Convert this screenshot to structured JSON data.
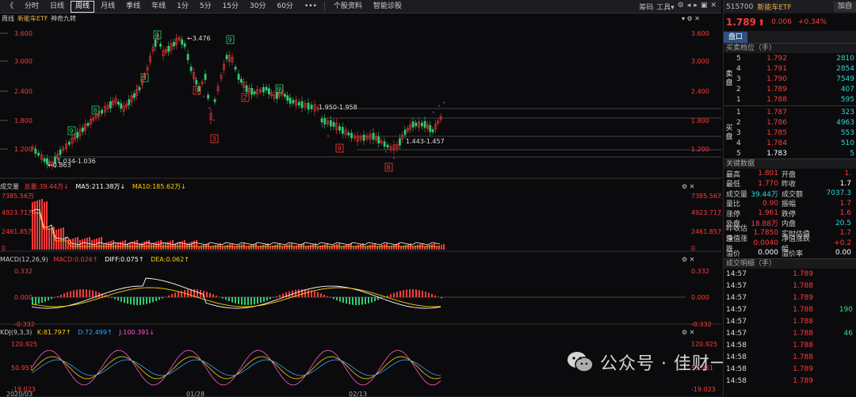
{
  "toolbar": {
    "back": "《",
    "items": [
      "分时",
      "日线",
      "周线",
      "月线",
      "季线",
      "年线",
      "1分",
      "5分",
      "15分",
      "30分",
      "60分",
      "•••",
      "个股资料",
      "智能诊股"
    ],
    "active": "周线",
    "right": [
      "筹码",
      "工具▾",
      "⚙",
      "◂",
      "▸",
      "▣",
      "✕"
    ]
  },
  "main_header": {
    "period": "周线",
    "name": "新能车ETF",
    "indicator": "神奇九转"
  },
  "price_axis": {
    "left": [
      "3.600",
      "3.000",
      "2.400",
      "1.800",
      "1.200"
    ],
    "right": [
      "3.600",
      "3.000",
      "2.400",
      "1.800",
      "1.200"
    ]
  },
  "annotations": {
    "high": "3.476",
    "low": "0.863",
    "low_range": "1.034-1.036",
    "mid_range": "1.950-1.958",
    "recent_range": "1.443-1.457",
    "arrow": "←"
  },
  "nine_turn_green": [
    "9",
    "8",
    "9",
    "9",
    "9",
    "9"
  ],
  "nine_turn_red": [
    "9",
    "2",
    "3",
    "9",
    "8",
    "9"
  ],
  "volume": {
    "title": "成交量",
    "total_label": "总量:39.44万↓",
    "ma5": "MA5:211.38万↓",
    "ma10": "MA10:185.62万↓",
    "axis": [
      "7385.56万",
      "4923.71万",
      "2461.85万",
      "0"
    ]
  },
  "macd": {
    "title": "MACD(12,26,9)",
    "macd": "MACD:0.026↑",
    "diff": "DIFF:0.075↑",
    "dea": "DEA:0.062↑",
    "axis": [
      "0.332",
      "0.000",
      "-0.332"
    ]
  },
  "kdj": {
    "title": "KDJ(9,3,3)",
    "k": "K:81.797↑",
    "d": "D:72.499↑",
    "j": "J:100.391↓",
    "axis": [
      "120.925",
      "50.951",
      "-19.023"
    ]
  },
  "dates": [
    "2020/03",
    "01/28",
    "02/13"
  ],
  "panel": {
    "code": "515700",
    "name": "新能车ETF",
    "add": "加自",
    "price": "1.789",
    "arrow": "🡅",
    "change": "0.006",
    "pct": "+0.34%",
    "tab": "盘口",
    "orderbook_title": "买卖档位（手）",
    "sell_side": "卖盘",
    "buy_side": "买盘",
    "asks": [
      {
        "l": "5",
        "p": "1.792",
        "v": "2810"
      },
      {
        "l": "4",
        "p": "1.791",
        "v": "2854"
      },
      {
        "l": "3",
        "p": "1.790",
        "v": "7549"
      },
      {
        "l": "2",
        "p": "1.789",
        "v": "407"
      },
      {
        "l": "1",
        "p": "1.788",
        "v": "595"
      }
    ],
    "bids": [
      {
        "l": "1",
        "p": "1.787",
        "v": "323"
      },
      {
        "l": "2",
        "p": "1.786",
        "v": "4963"
      },
      {
        "l": "3",
        "p": "1.785",
        "v": "553"
      },
      {
        "l": "4",
        "p": "1.784",
        "v": "510"
      },
      {
        "l": "5",
        "p": "1.783",
        "v": "5"
      }
    ],
    "key_title": "关键数据",
    "key": [
      {
        "k": "最高",
        "v": "1.801",
        "k2": "开盘",
        "v2": "1."
      },
      {
        "k": "最低",
        "v": "1.770",
        "k2": "昨收",
        "v2": "1.7"
      },
      {
        "k": "成交量",
        "v": "39.44万",
        "k2": "成交额",
        "v2": "7037.3"
      },
      {
        "k": "量比",
        "v": "0.90",
        "k2": "振幅",
        "v2": "1.7"
      },
      {
        "k": "涨停",
        "v": "1.961",
        "k2": "跌停",
        "v2": "1.6"
      },
      {
        "k": "外盘",
        "v": "18.88万",
        "k2": "内盘",
        "v2": "20.5"
      },
      {
        "k": "昨收估值",
        "v": "1.7850",
        "k2": "实时估值",
        "v2": "1.7"
      },
      {
        "k": "净值涨跌",
        "v": "0.0040",
        "k2": "净值涨跌幅",
        "v2": "+0.2"
      },
      {
        "k": "溢价",
        "v": "0.000",
        "k2": "溢价率",
        "v2": "0.00"
      }
    ],
    "trades_title": "成交明细（手）",
    "trades": [
      {
        "t": "14:57",
        "p": "1.789",
        "q": ""
      },
      {
        "t": "14:57",
        "p": "1.788",
        "q": ""
      },
      {
        "t": "14:57",
        "p": "1.789",
        "q": ""
      },
      {
        "t": "14:57",
        "p": "1.788",
        "q": "190"
      },
      {
        "t": "14:57",
        "p": "1.788",
        "q": ""
      },
      {
        "t": "14:57",
        "p": "1.788",
        "q": "46"
      },
      {
        "t": "14:58",
        "p": "1.788",
        "q": ""
      },
      {
        "t": "14:58",
        "p": "1.788",
        "q": ""
      },
      {
        "t": "14:58",
        "p": "1.789",
        "q": ""
      },
      {
        "t": "14:58",
        "p": "1.789",
        "q": ""
      }
    ]
  },
  "watermark": "公众号 · 佳财一分钟",
  "colors": {
    "up": "#ff3b3b",
    "down": "#2ecc71",
    "ma5": "#ffffff",
    "ma10": "#ffd000",
    "d": "#3aa3ff",
    "j": "#ff5ad2",
    "green9": "#2ecc71",
    "red9": "#ff3b3b",
    "purple": "#c45cd6"
  }
}
